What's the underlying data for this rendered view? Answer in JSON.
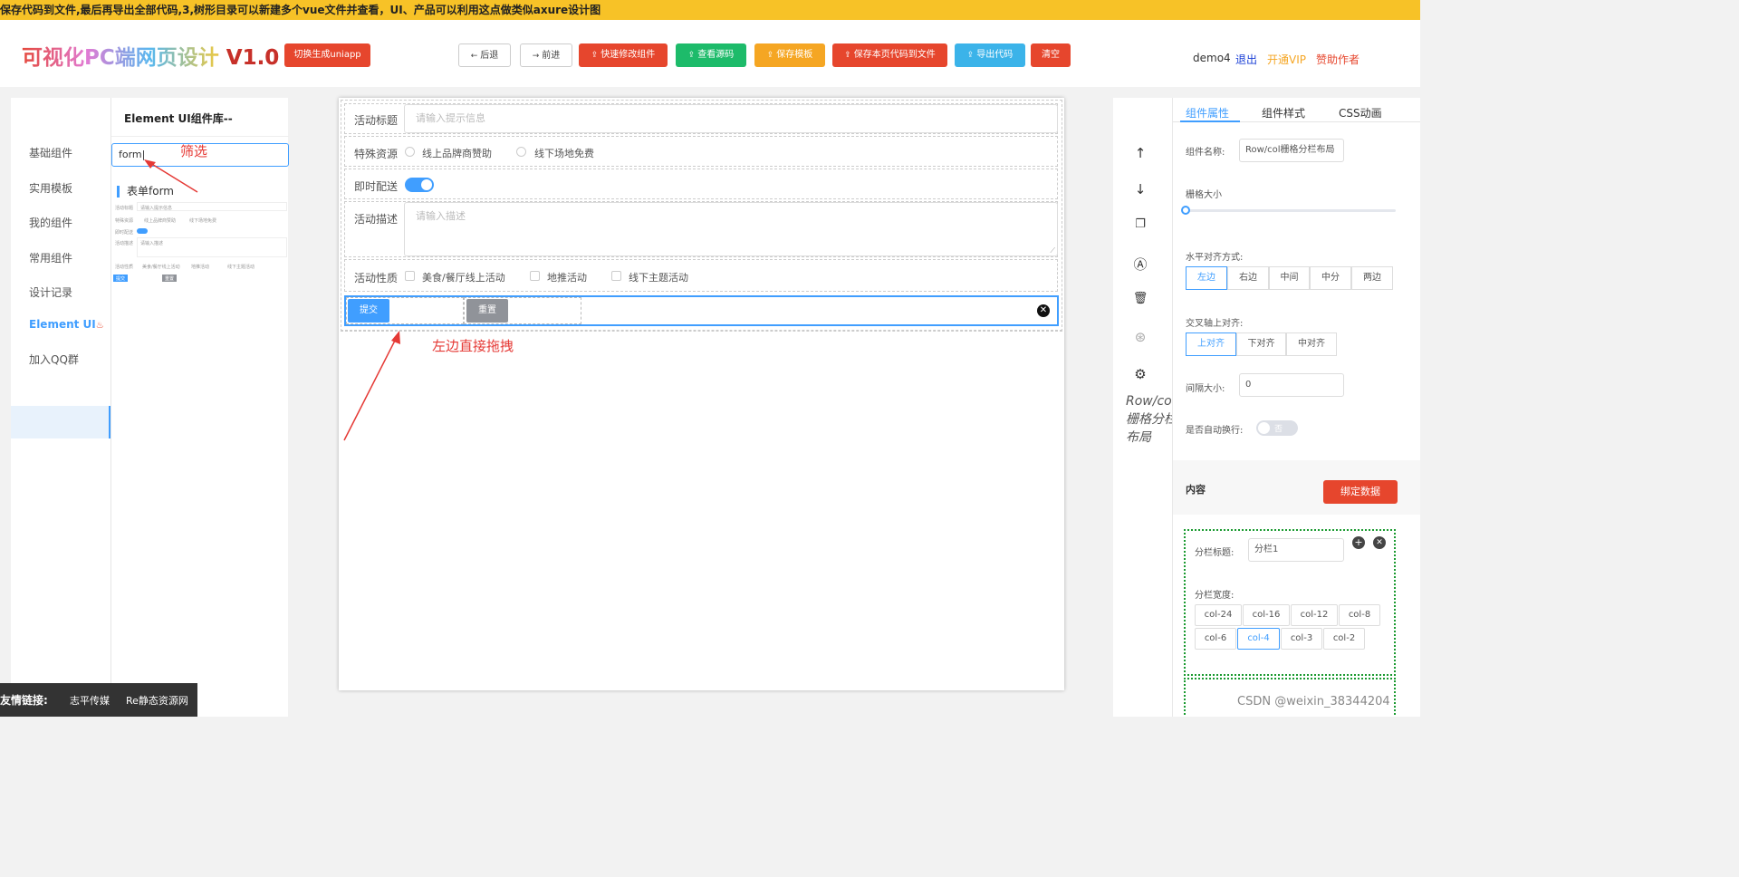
{
  "notice": "保存代码到文件,最后再导出全部代码,3,树形目录可以新建多个vue文件并查看，UI、产品可以利用这点做类似axure设计图",
  "header": {
    "logo_text": "可视化PC端网页设计",
    "logo_version": "V1.0",
    "switch_button": "切换生成uniapp",
    "toolbar": {
      "back": "后退",
      "forward": "前进",
      "quick_edit": "快速修改组件",
      "view_source": "查看源码",
      "save_template": "保存模板",
      "save_page_code": "保存本页代码到文件",
      "export_code": "导出代码",
      "clear": "清空"
    },
    "user": "demo4",
    "logout": "退出",
    "vip": "开通VIP",
    "donate": "赞助作者"
  },
  "colors": {
    "notice_bg": "#f7c227",
    "primary": "#409eff",
    "danger": "#e6462d",
    "success": "#1dbb6a",
    "warning": "#f5a623",
    "info": "#3bb3e9",
    "annotation": "#e53935"
  },
  "sidebar": {
    "items": [
      "基础组件",
      "实用模板",
      "我的组件",
      "常用组件",
      "设计记录",
      "Element UI",
      "加入QQ群"
    ]
  },
  "library": {
    "title": "Element UI组件库--",
    "search_value": "form",
    "form_title": "表单form",
    "preview": {
      "label1": "活动标题",
      "hint1": "请输入提示信息",
      "label2": "特殊资源",
      "opt1": "线上品牌商赞助",
      "opt2": "线下场地免费",
      "label3": "即时配送",
      "label4": "活动描述",
      "hint4": "请输入描述",
      "label5": "活动性质",
      "c1": "美食/餐厅线上活动",
      "c2": "地推活动",
      "c3": "线下主题活动",
      "submit": "提交",
      "reset": "重置"
    }
  },
  "annotations": {
    "filter": "筛选",
    "drag": "左边直接拖拽"
  },
  "form": {
    "title_label": "活动标题",
    "title_placeholder": "请输入提示信息",
    "resource_label": "特殊资源",
    "resource_options": [
      "线上品牌商赞助",
      "线下场地免费"
    ],
    "delivery_label": "即时配送",
    "delivery_on": true,
    "desc_label": "活动描述",
    "desc_placeholder": "请输入描述",
    "nature_label": "活动性质",
    "nature_options": [
      "美食/餐厅线上活动",
      "地推活动",
      "线下主题活动"
    ],
    "submit": "提交",
    "reset": "重置"
  },
  "toolstrip": {
    "label": "Row/col栅格分栏布局"
  },
  "props": {
    "tabs": [
      "组件属性",
      "组件样式",
      "CSS动画"
    ],
    "name_label": "组件名称:",
    "name_value": "Row/col栅格分栏布局",
    "grid_size_label": "栅格大小",
    "h_align_label": "水平对齐方式:",
    "h_align_options": [
      "左边",
      "右边",
      "中间",
      "中分",
      "两边"
    ],
    "h_align_selected": "左边",
    "cross_align_label": "交叉轴上对齐:",
    "cross_align_options": [
      "上对齐",
      "下对齐",
      "中对齐"
    ],
    "cross_align_selected": "上对齐",
    "gap_label": "间隔大小:",
    "gap_value": "0",
    "wrap_label": "是否自动换行:",
    "wrap_value": "否",
    "content_title": "内容",
    "bind_button": "绑定数据",
    "col_title_label": "分栏标题:",
    "col_title_value": "分栏1",
    "col_width_label": "分栏宽度:",
    "col_widths": [
      "col-24",
      "col-16",
      "col-12",
      "col-8",
      "col-6",
      "col-4",
      "col-3",
      "col-2"
    ],
    "col_width_selected": "col-4"
  },
  "footer": {
    "friend_label": "友情链接:",
    "links": [
      "志平传媒",
      "Re静态资源网"
    ],
    "watermark": "CSDN @weixin_38344204"
  }
}
